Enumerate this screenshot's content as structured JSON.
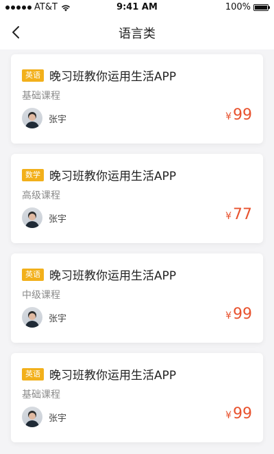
{
  "status_bar": {
    "carrier": "AT&T",
    "time": "9:41 AM",
    "battery": "100%",
    "battery_level": 100,
    "icons": [
      "signal-icon",
      "wifi-icon",
      "battery-icon"
    ]
  },
  "nav": {
    "title": "语言类",
    "back_icon": "chevron-left-icon"
  },
  "colors": {
    "tag_bg": "#f2b01b",
    "price": "#e8522e",
    "background": "#f4f4f6"
  },
  "courses": [
    {
      "tag": "英语",
      "title": "晚习班教你运用生活APP",
      "level": "基础课程",
      "teacher": "张宇",
      "currency": "¥",
      "price": "99"
    },
    {
      "tag": "数学",
      "title": "晚习班教你运用生活APP",
      "level": "高级课程",
      "teacher": "张宇",
      "currency": "¥",
      "price": "77"
    },
    {
      "tag": "英语",
      "title": "晚习班教你运用生活APP",
      "level": "中级课程",
      "teacher": "张宇",
      "currency": "¥",
      "price": "99"
    },
    {
      "tag": "英语",
      "title": "晚习班教你运用生活APP",
      "level": "基础课程",
      "teacher": "张宇",
      "currency": "¥",
      "price": "99"
    }
  ]
}
